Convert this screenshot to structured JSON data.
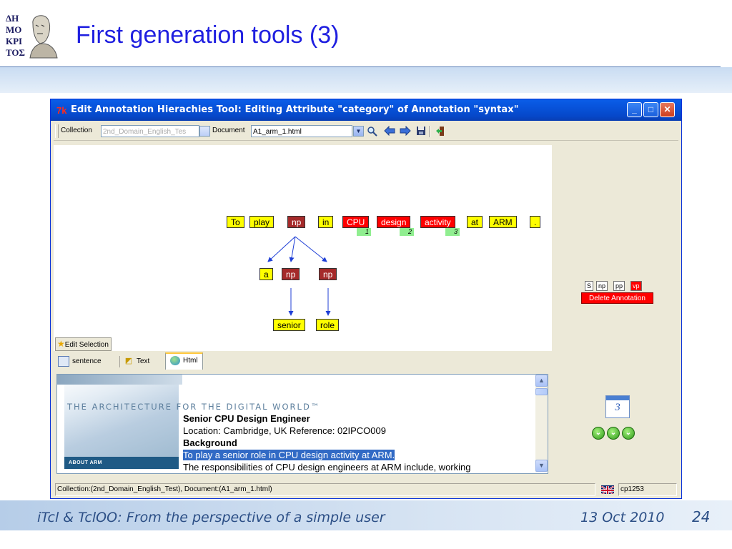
{
  "slide": {
    "title": "First generation tools (3)",
    "logo_icon": "portrait-logo-icon",
    "footer_left": "iTcl & TclOO: From the perspective of a simple user",
    "footer_date": "13 Oct 2010",
    "page_number": "24"
  },
  "window": {
    "app_icon_text": "7k",
    "title": "Edit Annotation Hierachies Tool: Editing Attribute \"category\" of Annotation \"syntax\"",
    "controls": {
      "minimize": "_",
      "maximize": "□",
      "close": "✕"
    }
  },
  "toolbar": {
    "collection_label": "Collection",
    "collection_value": "2nd_Domain_English_Tes",
    "document_label": "Document",
    "document_value": "A1_arm_1.html",
    "icons": [
      "search-icon",
      "back-arrow-icon",
      "forward-arrow-icon",
      "save-icon",
      "exit-icon"
    ]
  },
  "tree": {
    "tokens": [
      {
        "label": "To",
        "style": "yellow"
      },
      {
        "label": "play",
        "style": "yellow"
      },
      {
        "label": "np",
        "style": "brown"
      },
      {
        "label": "in",
        "style": "yellow"
      },
      {
        "label": "CPU",
        "style": "red",
        "index": "1"
      },
      {
        "label": "design",
        "style": "red",
        "index": "2"
      },
      {
        "label": "activity",
        "style": "red",
        "index": "3"
      },
      {
        "label": "at",
        "style": "yellow"
      },
      {
        "label": "ARM",
        "style": "yellow"
      },
      {
        "label": ".",
        "style": "yellow"
      }
    ],
    "children": [
      {
        "label": "a",
        "style": "yellow"
      },
      {
        "label": "np",
        "style": "brown"
      },
      {
        "label": "np",
        "style": "brown"
      }
    ],
    "leaves": [
      {
        "label": "senior",
        "style": "yellow"
      },
      {
        "label": "role",
        "style": "yellow"
      }
    ],
    "edge_color": "#1f3fd6"
  },
  "edit_selection_label": "Edit Selection",
  "category_buttons": [
    {
      "label": "S",
      "selected": false
    },
    {
      "label": "np",
      "selected": false
    },
    {
      "label": "pp",
      "selected": false
    },
    {
      "label": "vp",
      "selected": true
    }
  ],
  "delete_annotation_label": "Delete Annotation",
  "tabs": [
    {
      "label": "sentence",
      "icon": "sentence-icon",
      "active": false
    },
    {
      "label": "Text",
      "icon": "text-icon",
      "active": false
    },
    {
      "label": "Html",
      "icon": "html-globe-icon",
      "active": true
    }
  ],
  "html_view": {
    "banner_text": "THE ARCHITECTURE FOR THE DIGITAL WORLD™",
    "about_label": "ABOUT ARM",
    "lines": [
      {
        "text": "Senior CPU Design Engineer",
        "bold": true,
        "selected": false
      },
      {
        "text": "Location: Cambridge, UK Reference: 02IPCO009",
        "bold": false,
        "selected": false
      },
      {
        "text": "Background",
        "bold": true,
        "selected": false
      },
      {
        "text": "To play a senior role in CPU design activity at ARM.",
        "bold": false,
        "selected": true
      },
      {
        "text": "The responsibilities of CPU design engineers at ARM include, working",
        "bold": false,
        "selected": false
      }
    ]
  },
  "navigator": {
    "page_number": "3",
    "nav_buttons": [
      "nav-first-icon",
      "nav-prev-icon",
      "nav-next-icon"
    ]
  },
  "statusbar": {
    "status_text": "Collection:(2nd_Domain_English_Test), Document:(A1_arm_1.html)",
    "encoding": "cp1253",
    "flag_icon": "uk-flag-icon"
  }
}
